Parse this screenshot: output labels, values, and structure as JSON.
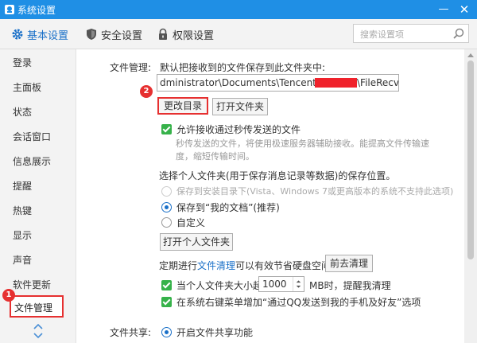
{
  "window": {
    "title": "系统设置",
    "minimize_glyph": "—",
    "close_glyph": "✕"
  },
  "toolbar": {
    "tabs": [
      {
        "label": "基本设置",
        "icon": "gear-icon"
      },
      {
        "label": "安全设置",
        "icon": "shield-icon"
      },
      {
        "label": "权限设置",
        "icon": "lock-icon"
      }
    ],
    "search_placeholder": "搜索设置项"
  },
  "sidebar": {
    "items": [
      {
        "label": "登录"
      },
      {
        "label": "主面板"
      },
      {
        "label": "状态"
      },
      {
        "label": "会话窗口"
      },
      {
        "label": "信息展示"
      },
      {
        "label": "提醒"
      },
      {
        "label": "热键"
      },
      {
        "label": "显示"
      },
      {
        "label": "声音"
      },
      {
        "label": "软件更新"
      },
      {
        "label": "文件管理"
      }
    ],
    "active_index": 10
  },
  "badges": {
    "first": "1",
    "second": "2"
  },
  "file_management": {
    "section_label": "文件管理:",
    "description": "默认把接收到的文件保存到此文件夹中:",
    "path_prefix": "dministrator\\Documents\\Tencent Files\\",
    "path_suffix": "\\FileRecv\\",
    "change_dir_button": "更改目录",
    "open_folder_button": "打开文件夹",
    "flash_transfer": {
      "label": "允许接收通过秒传发送的文件",
      "desc_line1": "秒传发送的文件，将使用极速服务器辅助接收。能提高文件传输速",
      "desc_line2": "度，缩短传输时间。",
      "checked": true
    },
    "personal_folder_heading": "选择个人文件夹(用于保存消息记录等数据)的保存位置。",
    "options": [
      {
        "label": "保存到安装目录下(Vista、Windows 7或更高版本的系统不支持此选项)",
        "disabled": true,
        "selected": false
      },
      {
        "label": "保存到“我的文档”(推荐)",
        "disabled": false,
        "selected": true
      },
      {
        "label": "自定义",
        "disabled": false,
        "selected": false
      }
    ],
    "open_personal_folder_button": "打开个人文件夹",
    "cleanup": {
      "prefix": "定期进行",
      "link": "文件清理",
      "suffix": "可以有效节省硬盘空间。",
      "button": "前去清理"
    },
    "size_warning": {
      "prefix": "当个人文件夹大小超过",
      "value": "1000",
      "suffix": "MB时，提醒我清理",
      "checked": true
    },
    "context_menu": {
      "label": "在系统右键菜单增加“通过QQ发送到我的手机及好友”选项",
      "checked": true
    }
  },
  "file_sharing": {
    "section_label": "文件共享:",
    "option": "开启文件共享功能",
    "selected": true
  },
  "colors": {
    "accent": "#1f8fe5",
    "highlight": "#e63030",
    "check": "#36b24a",
    "link": "#1a70c8"
  }
}
